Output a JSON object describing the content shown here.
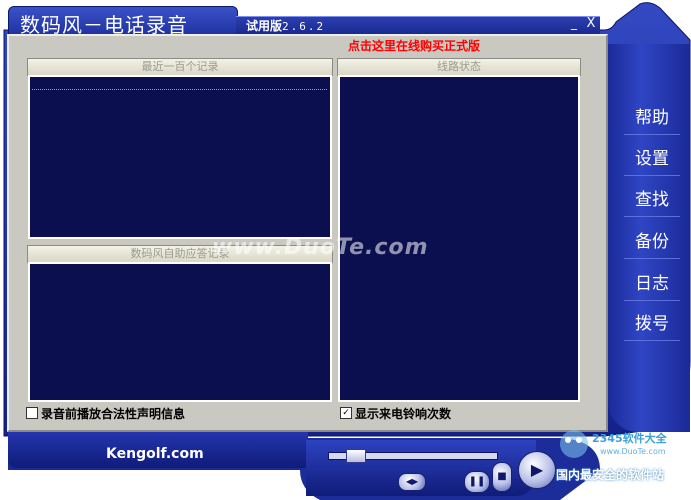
{
  "window": {
    "title": "数码风－电话录音",
    "version_label": "试用版",
    "version_number": "2.6.2",
    "minimize_glyph": "_",
    "close_glyph": "X"
  },
  "banner": {
    "buy_link": "点击这里在线购买正式版"
  },
  "panes": {
    "recent_header": "最近一百个记录",
    "auto_answer_header": "数码风自助应答记录",
    "line_status_header": "线路状态"
  },
  "options": {
    "law_notice_label": "录音前播放合法性声明信息",
    "law_notice_checked": false,
    "ring_count_label": "显示来电铃响次数",
    "ring_count_checked": true
  },
  "side_menu": {
    "items": [
      {
        "label": "帮助"
      },
      {
        "label": "设置"
      },
      {
        "label": "查找"
      },
      {
        "label": "备份"
      },
      {
        "label": "日志"
      },
      {
        "label": "拨号"
      }
    ]
  },
  "footer": {
    "site": "Kengolf.com"
  },
  "player": {
    "seek_position": 0.12,
    "play_glyph": "▶",
    "pause_glyph": "❚❚",
    "stop_glyph": "■",
    "eject_glyph": "◀▶"
  },
  "watermarks": {
    "center": "www.DuoTe.com",
    "logo_title": "2345软件大全",
    "logo_url": "www.DuoTe.com",
    "logo_slogan": "国内最安全的软件站"
  },
  "colors": {
    "skin_blue": "#1c2d9a",
    "pane_navy": "#0b0f4f",
    "panel_gray": "#c9c9c2",
    "buy_red": "#ff0000"
  }
}
